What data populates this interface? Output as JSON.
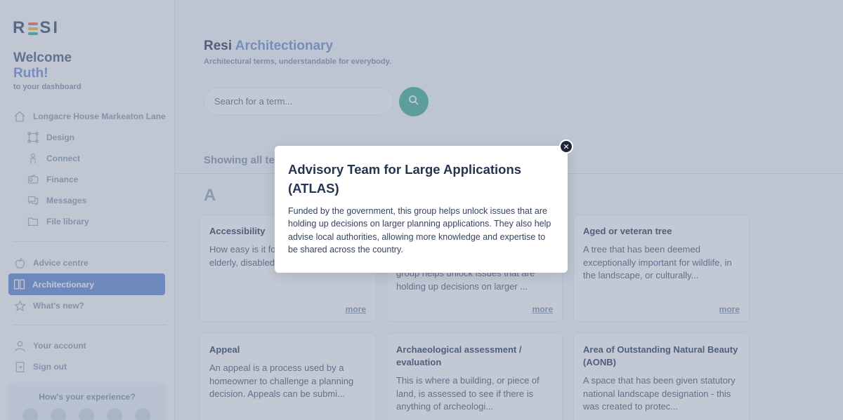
{
  "brand": {
    "logo": "RESI",
    "logo_left": "R",
    "logo_right": "SI",
    "bar_colors": [
      "#e07f5c",
      "#f0c24b",
      "#52b49e"
    ]
  },
  "sidebar": {
    "welcome_line1": "Welcome",
    "welcome_name": "Ruth!",
    "welcome_line3": "to your dashboard",
    "project": {
      "label": "Longacre House Markeaton Lane",
      "icon": "house-icon"
    },
    "project_items": [
      {
        "label": "Design",
        "icon": "design-frame-icon"
      },
      {
        "label": "Connect",
        "icon": "connect-people-icon"
      },
      {
        "label": "Finance",
        "icon": "wallet-icon"
      },
      {
        "label": "Messages",
        "icon": "chat-icon"
      },
      {
        "label": "File library",
        "icon": "folder-icon"
      }
    ],
    "main_items": [
      {
        "label": "Advice centre",
        "icon": "apple-icon"
      },
      {
        "label": "Architectionary",
        "icon": "book-icon",
        "active": true
      },
      {
        "label": "What's new?",
        "icon": "star-icon"
      }
    ],
    "account_items": [
      {
        "label": "Your account",
        "icon": "user-icon"
      },
      {
        "label": "Sign out",
        "icon": "sign-out-icon"
      }
    ],
    "experience_label": "How's your experience?"
  },
  "main": {
    "title_plain": "Resi",
    "title_accent": "Architectionary",
    "subtitle": "Architectural terms, understandable for everybody.",
    "search_placeholder": "Search for a term...",
    "showing_label": "Showing all ter",
    "letter": "A",
    "more_label": "more",
    "cards_row1": [
      {
        "title": "Accessibility",
        "body": "How easy is it fo around your bui the elderly, disabled, pare..."
      },
      {
        "title": "",
        "body": "group helps unlock issues that are holding up decisions on larger ..."
      },
      {
        "title": "Aged or veteran tree",
        "body": "A tree that has been deemed exceptionally important for wildlife, in the landscape, or culturally..."
      }
    ],
    "cards_row2": [
      {
        "title": "Appeal",
        "body": "An appeal is a process used by a homeowner to challenge a planning decision. Appeals can be submi..."
      },
      {
        "title": "Archaeological assessment / evaluation",
        "body": "This is where a building, or piece of land, is assessed to see if there is anything of archeologi..."
      },
      {
        "title": "Area of Outstanding Natural Beauty (AONB)",
        "body": "A space that has been given statutory national landscape designation - this was created to protec..."
      }
    ]
  },
  "modal": {
    "title": "Advisory Team for Large Applications (ATLAS)",
    "body": "Funded by the government, this group helps unlock issues that are holding up decisions on larger planning applications. They also help advise local authorities, allowing more knowledge and expertise to be shared across the country.",
    "close_icon": "close-icon"
  }
}
